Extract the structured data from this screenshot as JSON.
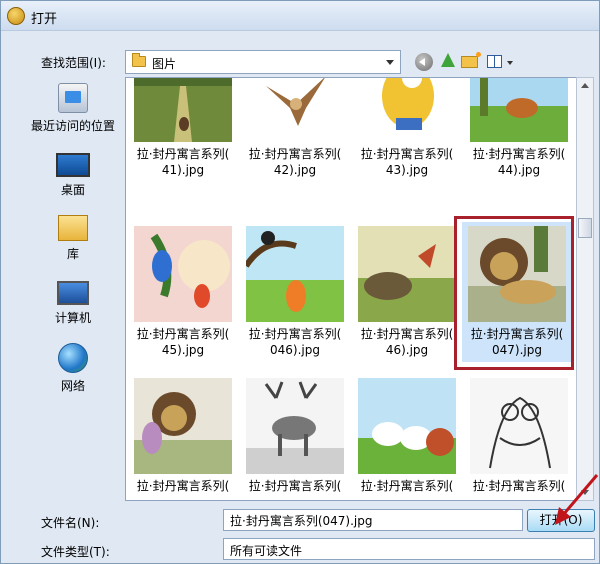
{
  "window": {
    "title": "打开"
  },
  "lookin": {
    "label": "查找范围(I):",
    "value": "图片"
  },
  "sidebar": {
    "items": [
      {
        "label": "最近访问的位置",
        "icon": "recent-places-icon"
      },
      {
        "label": "桌面",
        "icon": "desktop-icon"
      },
      {
        "label": "库",
        "icon": "library-icon"
      },
      {
        "label": "计算机",
        "icon": "computer-icon"
      },
      {
        "label": "网络",
        "icon": "network-icon"
      }
    ]
  },
  "files": [
    {
      "line1": "拉·封丹寓言系列(",
      "line2": "41).jpg"
    },
    {
      "line1": "拉·封丹寓言系列(",
      "line2": "42).jpg"
    },
    {
      "line1": "拉·封丹寓言系列(",
      "line2": "43).jpg"
    },
    {
      "line1": "拉·封丹寓言系列(",
      "line2": "44).jpg"
    },
    {
      "line1": "拉·封丹寓言系列(",
      "line2": "45).jpg"
    },
    {
      "line1": "拉·封丹寓言系列(",
      "line2": "046).jpg"
    },
    {
      "line1": "拉·封丹寓言系列(",
      "line2": "46).jpg"
    },
    {
      "line1": "拉·封丹寓言系列(",
      "line2": "047).jpg",
      "selected": true
    },
    {
      "line1": "拉·封丹寓言系列(",
      "line2": ""
    },
    {
      "line1": "拉·封丹寓言系列(",
      "line2": ""
    },
    {
      "line1": "拉·封丹寓言系列(",
      "line2": ""
    },
    {
      "line1": "拉·封丹寓言系列(",
      "line2": ""
    }
  ],
  "filename": {
    "label": "文件名(N):",
    "value": "拉·封丹寓言系列(047).jpg"
  },
  "filetype": {
    "label": "文件类型(T):",
    "value": "所有可读文件"
  },
  "buttons": {
    "open": "打开(O)"
  },
  "colors": {
    "selection_frame": "#a7202b",
    "selection_fill": "#cde4fb",
    "annotation_arrow": "#c0151b"
  }
}
